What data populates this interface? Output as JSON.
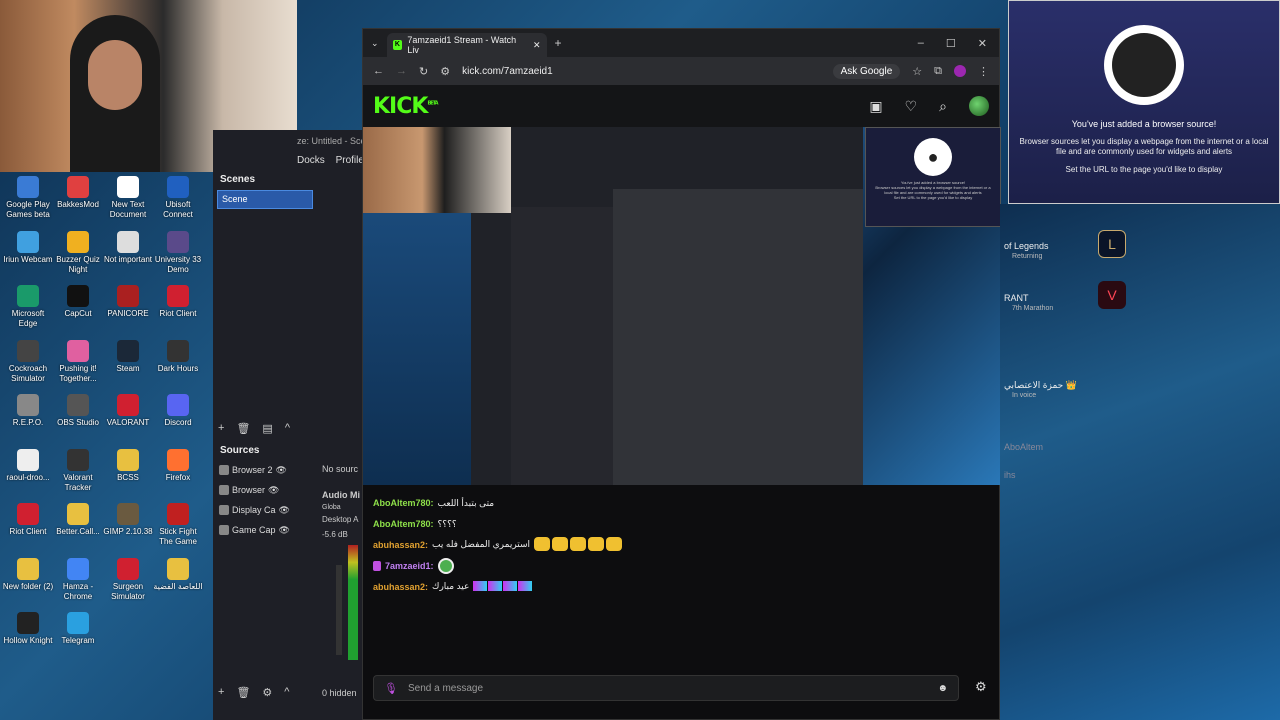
{
  "desktop": {
    "icons": [
      {
        "label": "Google Play Games beta"
      },
      {
        "label": "BakkesMod"
      },
      {
        "label": "New Text Document"
      },
      {
        "label": "Ubisoft Connect"
      },
      {
        "label": "Iriun Webcam"
      },
      {
        "label": "Buzzer Quiz Night"
      },
      {
        "label": "Not important"
      },
      {
        "label": "University 33 Demo"
      },
      {
        "label": "Microsoft Edge"
      },
      {
        "label": "CapCut"
      },
      {
        "label": "PANICORE"
      },
      {
        "label": "Riot Client"
      },
      {
        "label": "Cockroach Simulator"
      },
      {
        "label": "Pushing it! Together..."
      },
      {
        "label": "Steam"
      },
      {
        "label": "Dark Hours"
      },
      {
        "label": "R.E.P.O."
      },
      {
        "label": "OBS Studio"
      },
      {
        "label": "VALORANT"
      },
      {
        "label": "Discord"
      },
      {
        "label": "raoul-droo..."
      },
      {
        "label": "Valorant Tracker"
      },
      {
        "label": "BCSS"
      },
      {
        "label": "Firefox"
      },
      {
        "label": "Riot Client"
      },
      {
        "label": "Better.Call..."
      },
      {
        "label": "GIMP 2.10.38"
      },
      {
        "label": "Stick Fight The Game"
      },
      {
        "label": "New folder (2)"
      },
      {
        "label": "Hamza - Chrome"
      },
      {
        "label": "Surgeon Simulator"
      },
      {
        "label": "اللعاصة الفضية"
      },
      {
        "label": "Hollow Knight"
      },
      {
        "label": "Telegram"
      }
    ]
  },
  "obs": {
    "title": "ze: Untitled - Scene",
    "menu": [
      "Docks",
      "Profile"
    ],
    "scenes_header": "Scenes",
    "scene_item": "Scene",
    "sources_header": "Sources",
    "sources": [
      "Browser 2",
      "Browser",
      "Display Ca",
      "Game Cap"
    ],
    "no_source": "No sourc",
    "audio_mixer": "Audio Mi",
    "audio_labels": [
      "Globa",
      "Desktop A",
      "-5.6 dB"
    ],
    "hidden_label": "0 hidden"
  },
  "browser": {
    "tab_title": "7amzaeid1 Stream - Watch Liv",
    "url": "kick.com/7amzaeid1",
    "ask_google": "Ask Google",
    "profile_initial": "I",
    "kick": {
      "logo": "KICK",
      "logo_badge": "BETA"
    },
    "video_popup": {
      "line1": "You've just added a browser source!",
      "line2": "Browser sources let you display a webpage from the internet or a local file and are commonly used for widgets and alerts",
      "line3": "Set the URL to the page you'd like to display"
    },
    "chat": {
      "messages": [
        {
          "user": "AboAltem780:",
          "user_color": "#8ee04a",
          "text": "متى بتبدأ اللعب"
        },
        {
          "user": "AboAltem780:",
          "user_color": "#8ee04a",
          "text": "؟؟؟؟"
        },
        {
          "user": "abuhassan2:",
          "user_color": "#e0a030",
          "text": "استريمري المفضل فله يب"
        },
        {
          "user": "7amzaeid1:",
          "user_color": "#c080f0",
          "text": ""
        },
        {
          "user": "abuhassan2:",
          "user_color": "#e0a030",
          "text": "عيد مبارك"
        }
      ],
      "input_placeholder": "Send a message"
    }
  },
  "obs_popup": {
    "line1": "You've just added a browser source!",
    "line2": "Browser sources let you display a webpage from the internet or a local file and are commonly used for widgets and alerts",
    "line3": "Set the URL to the page you'd like to display"
  },
  "discord_strip": {
    "items": [
      {
        "label": "of Legends",
        "sub": "Returning"
      },
      {
        "label": "RANT",
        "sub": "7th Marathon"
      },
      {
        "label": "حمزة الاعتصابي 👑",
        "sub": "In voice"
      },
      {
        "label": "AboAltem",
        "sub": ""
      },
      {
        "label": "ihs",
        "sub": ""
      }
    ]
  }
}
